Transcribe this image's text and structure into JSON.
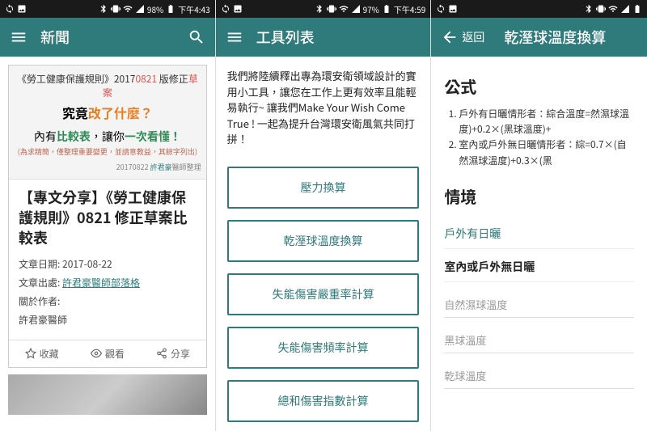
{
  "screen1": {
    "status": {
      "battery": "98%",
      "time": "下午4:43"
    },
    "appbar": {
      "title": "新聞"
    },
    "banner": {
      "line1_pre": "《勞工健康保護規則》2017",
      "line1_red": "0821",
      "line1_mid": " 版修正",
      "line1_red2": "草案",
      "line2_pre": "究竟",
      "line2_orange": "改了什麼？",
      "line3_pre": "內有",
      "line3_green1": "比較表",
      "line3_mid": "，讓你",
      "line3_green2": "一次看懂！",
      "line4": "(為求精簡，僅整理重要變更，並請意教益，其餘字列出)",
      "credit_date": "20170822 ",
      "credit_link": "許君豪",
      "credit_suffix": "醫師整理"
    },
    "article": {
      "title": "【專文分享】《勞工健康保護規則》0821 修正草案比較表",
      "date_label": "文章日期: ",
      "date_value": "2017-08-22",
      "source_label": "文章出處: ",
      "source_link": "許君豪醫師部落格",
      "author_label": "關於作者:",
      "author_name": "許君豪醫師"
    },
    "actions": {
      "fav": "收藏",
      "view": "觀看",
      "share": "分享"
    }
  },
  "screen2": {
    "status": {
      "battery": "97%",
      "time": "下午4:59"
    },
    "appbar": {
      "title": "工具列表"
    },
    "intro": "我們將陸續釋出專為環安衛領域設計的實用小工具，讓您在工作上更有效率且能輕易執行~ 讓我們Make Your Wish Come True ! 一起為提升台灣環安衛風氣共同打拼！",
    "tools": [
      "壓力換算",
      "乾溼球溫度換算",
      "失能傷害嚴重率計算",
      "失能傷害頻率計算",
      "總和傷害指數計算"
    ]
  },
  "screen3": {
    "status": {
      "battery": "",
      "time": ""
    },
    "appbar": {
      "back": "返回",
      "title": "乾溼球溫度換算"
    },
    "formula_title": "公式",
    "formulas": [
      "戶外有日曬情形者：綜合溫度=然濕球溫度)+0.2×(黑球溫度)+",
      "室內或戶外無日曬情形者：綜=0.7×(自然濕球溫度)+0.3×(黑"
    ],
    "scenario_title": "情境",
    "scenarios": [
      "戶外有日曬",
      "室內或戶外無日曬"
    ],
    "inputs": [
      "自然濕球溫度",
      "黑球溫度",
      "乾球溫度"
    ]
  }
}
